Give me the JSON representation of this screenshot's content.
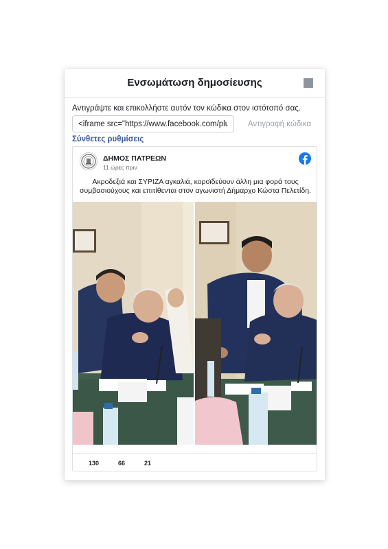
{
  "dialog": {
    "title": "Ενσωμάτωση δημοσίευσης",
    "instruction": "Αντιγράψτε και επικολλήστε αυτόν τον κώδικα στον ιστότοπό σας.",
    "code_value": "<iframe src=\"https://www.facebook.com/plugins/post.php",
    "copy_button": "Αντιγραφή κώδικα",
    "advanced_settings": "Σύνθετες ρυθμίσεις"
  },
  "post": {
    "page_name": "ΔΗΜΟΣ ΠΑΤΡΕΩΝ",
    "time": "11 ώρες πριν",
    "text": "Ακροδεξιά και ΣΥΡΙΖΑ αγκαλιά, κοροϊδεύουν άλλη μια φορά τους συμβασιούχους και επιτίθενται στον αγωνιστή Δήμαρχο Κώστα Πελετίδη.",
    "photos": [
      "photo-meeting-left",
      "photo-meeting-right"
    ],
    "counts": {
      "reactions": "130",
      "comments": "66",
      "shares": "21"
    }
  },
  "icons": [
    "close-icon",
    "facebook-logo-icon",
    "municipality-seal-icon"
  ],
  "colors": {
    "link": "#385898",
    "facebook_blue": "#1877f2",
    "close_gray": "#8d949e",
    "table_green": "#3e5a4a"
  }
}
